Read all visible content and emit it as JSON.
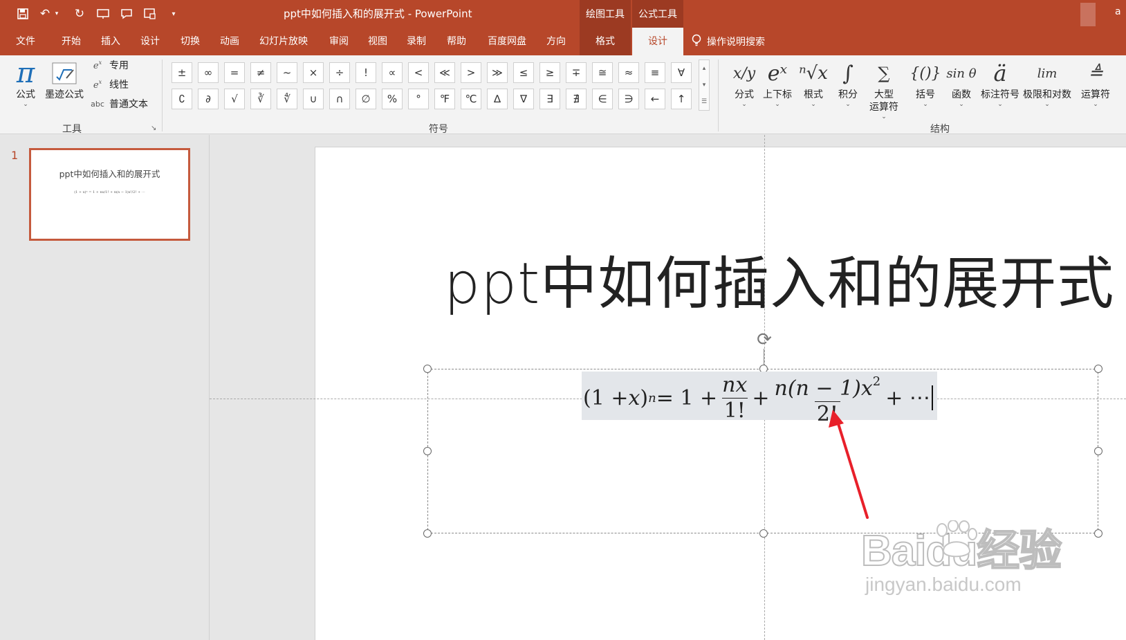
{
  "app": {
    "title": "ppt中如何插入和的展开式  -  PowerPoint",
    "user_fragment": "a"
  },
  "quick_access": [
    "save-icon",
    "undo-icon",
    "redo-icon",
    "present-icon",
    "comment-icon",
    "layout-icon",
    "customize-icon"
  ],
  "context_groups": {
    "drawing_tools": "绘图工具",
    "equation_tools": "公式工具"
  },
  "tabs": {
    "file": "文件",
    "home": "开始",
    "insert": "插入",
    "design": "设计",
    "transitions": "切换",
    "animations": "动画",
    "slideshow": "幻灯片放映",
    "review": "审阅",
    "view": "视图",
    "record": "录制",
    "help": "帮助",
    "baidu": "百度网盘",
    "direction": "方向",
    "format": "格式",
    "eq_design": "设计"
  },
  "tell_me": "操作说明搜索",
  "ribbon": {
    "tools": {
      "label": "工具",
      "equation": "公式",
      "ink": "墨迹公式",
      "professional": "专用",
      "linear": "线性",
      "normal_text": "普通文本"
    },
    "symbols": {
      "label": "符号",
      "row1": [
        "±",
        "∞",
        "=",
        "≠",
        "~",
        "×",
        "÷",
        "!",
        "∝",
        "<",
        "≪",
        ">",
        "≫",
        "≤",
        "≥",
        "∓",
        "≅",
        "≈",
        "≡",
        "∀"
      ],
      "row2": [
        "∁",
        "∂",
        "√",
        "∛",
        "∜",
        "∪",
        "∩",
        "∅",
        "%",
        "°",
        "℉",
        "℃",
        "∆",
        "∇",
        "∃",
        "∄",
        "∈",
        "∋",
        "←",
        "↑"
      ]
    },
    "structures": {
      "label": "结构",
      "items": [
        {
          "label": "分式",
          "icon": "x/y"
        },
        {
          "label": "上下标",
          "icon": "eˣ"
        },
        {
          "label": "根式",
          "icon": "ⁿ√x"
        },
        {
          "label": "积分",
          "icon": "∫"
        },
        {
          "label": "大型\n运算符",
          "icon": "∑"
        },
        {
          "label": "括号",
          "icon": "{()}"
        },
        {
          "label": "函数",
          "icon": "sin θ"
        },
        {
          "label": "标注符号",
          "icon": "ä"
        },
        {
          "label": "极限和对数",
          "icon": "lim"
        },
        {
          "label": "运算符",
          "icon": "≜"
        }
      ]
    }
  },
  "thumbnail": {
    "slide_number": "1",
    "title": "ppt中如何插入和的展开式",
    "formula": "(1 + x)ⁿ = 1 + nx/1! + n(n − 1)x²/2! + ⋯"
  },
  "slide": {
    "title": "ppt中如何插入和的展开式"
  },
  "equation": {
    "lhs": "(1 + ",
    "x": "x",
    "close": ")",
    "n": "n",
    "eq": " = 1 + ",
    "frac1_num": "nx",
    "frac1_den": "1!",
    "plus": " + ",
    "frac2_num": "n(n − 1)x",
    "frac2_sup": "2",
    "frac2_den": "2!",
    "tail": " + ⋯"
  },
  "annotation": {
    "arrow_color": "#e8202a"
  },
  "watermark": {
    "logo": "Baidu经验",
    "url": "jingyan.baidu.com"
  },
  "colors": {
    "accent": "#b7472a",
    "context_tab": "#9c3a22"
  }
}
